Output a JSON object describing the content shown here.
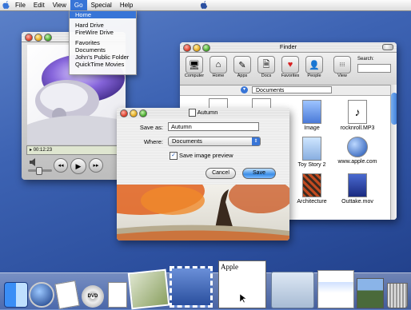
{
  "menubar": {
    "items": [
      "File",
      "Edit",
      "View",
      "Go",
      "Special",
      "Help"
    ],
    "active": "Go"
  },
  "go_menu": {
    "items": [
      "Home",
      "Hard Drive",
      "FireWire Drive",
      "Favorites",
      "Documents",
      "John's Public Folder",
      "QuickTime Movies"
    ]
  },
  "quicktime": {
    "timecode": "00:12:23"
  },
  "finder": {
    "title": "Finder",
    "toolbar": [
      "Computer",
      "Home",
      "Apps",
      "Docs",
      "Favorites",
      "People",
      "View"
    ],
    "search_label": "Search:",
    "path": "Documents",
    "files": [
      "Image",
      "rocknroll.MP3",
      "Toy Story 2",
      "www.apple.com",
      "Architecture",
      "Outtake.mov"
    ]
  },
  "save_sheet": {
    "title": "Autumn",
    "save_as_label": "Save as:",
    "save_as_value": "Autumn",
    "where_label": "Where:",
    "where_value": "Documents",
    "checkbox_label": "Save image preview",
    "checkbox_checked": true,
    "cancel_label": "Cancel",
    "save_label": "Save"
  },
  "dock": {
    "items": [
      "finder-icon",
      "quicktime-icon",
      "textedit-icon",
      "dvd-player-icon",
      "document-icon",
      "iphoto-icon",
      "mail-stamp-icon",
      "stamp-icon",
      "apple-web-document-icon",
      "folder-icon",
      "web-page-icon",
      "landscape-image-icon",
      "trash-icon"
    ],
    "dvd_label": "DVD",
    "apple_doc_label": "Apple"
  },
  "colors": {
    "accent": "#3875d7",
    "desktop": "#3d63b3"
  }
}
